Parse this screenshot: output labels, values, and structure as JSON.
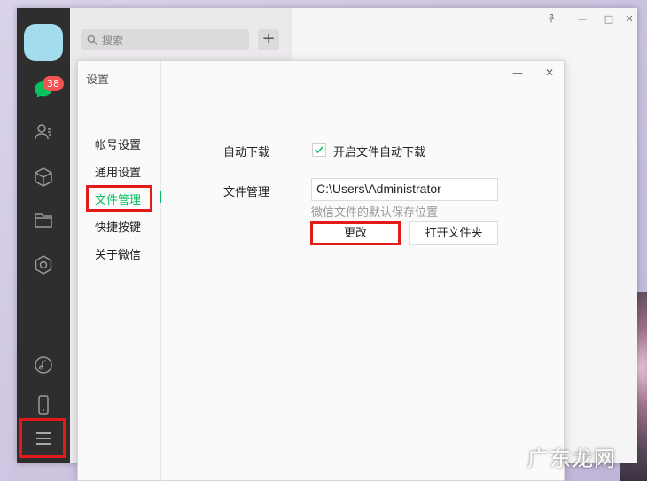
{
  "sidebar": {
    "badge_count": "38",
    "icons": [
      "chat-icon",
      "contacts-icon",
      "box-icon",
      "folder-icon",
      "hexagon-icon",
      "music-icon",
      "phone-icon",
      "menu-icon"
    ]
  },
  "search": {
    "placeholder": "搜索",
    "add_label": "+"
  },
  "main_window_controls": {
    "pin": "📌",
    "minimize": "—",
    "maximize": "□",
    "close": "✕"
  },
  "settings": {
    "title": "设置",
    "controls": {
      "minimize": "—",
      "close": "✕"
    },
    "nav": [
      {
        "label": "帐号设置"
      },
      {
        "label": "通用设置"
      },
      {
        "label": "文件管理",
        "active": true
      },
      {
        "label": "快捷按键"
      },
      {
        "label": "关于微信"
      }
    ],
    "auto_download": {
      "label": "自动下载",
      "checkbox_label": "开启文件自动下载",
      "checked": true
    },
    "file_management": {
      "label": "文件管理",
      "path": "C:\\Users\\Administrator",
      "hint": "微信文件的默认保存位置",
      "change_label": "更改",
      "open_folder_label": "打开文件夹"
    }
  },
  "colors": {
    "accent": "#07c160",
    "highlight": "#e21a1a",
    "badge": "#f35353"
  },
  "watermark": "广东龙网"
}
